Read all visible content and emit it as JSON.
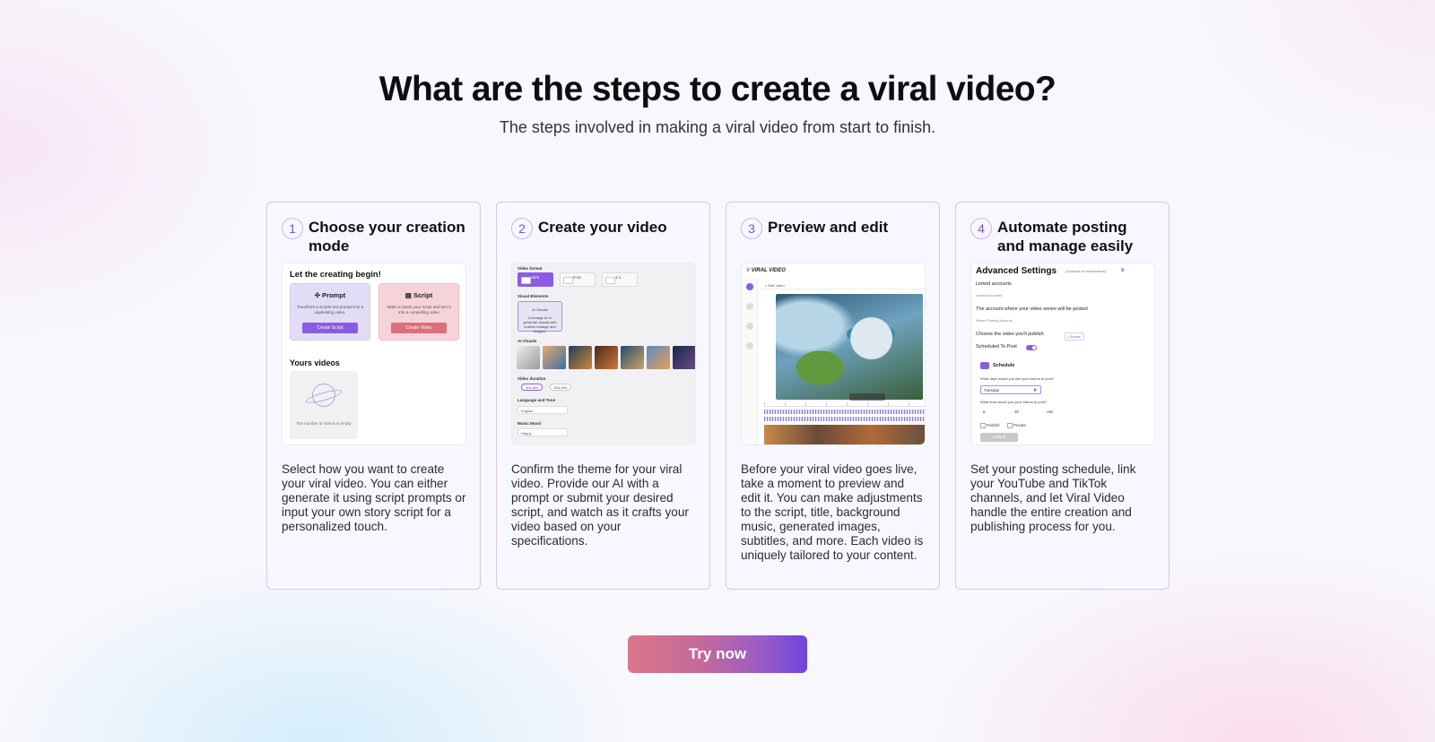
{
  "header": {
    "title": "What are the steps to create a viral video?",
    "subtitle": "The steps involved in making a viral video from start to finish."
  },
  "steps": [
    {
      "number": "1",
      "title": "Choose your creation mode",
      "description": "Select how you want to create your viral video. You can either generate it using script prompts or input your own story script for a personalized touch.",
      "preview": {
        "heading": "Let the creating begin!",
        "prompt_title": "✣ Prompt",
        "prompt_text": "Transform a simple text prompt into a captivating video.",
        "prompt_button": "Create Script",
        "script_title": "▤ Script",
        "script_text": "Write or paste your script and turn it into a compelling video",
        "script_button": "Create Video",
        "videos_heading": "Yours videos",
        "empty_text": "The number of videos is empty"
      }
    },
    {
      "number": "2",
      "title": "Create your video",
      "description": "Confirm the theme for your viral video. Provide our AI with a prompt or submit your desired script, and watch as it crafts your video based on your specifications.",
      "preview": {
        "ratio_label": "Video format",
        "ratios": [
          "16:9",
          "9:16",
          "1:1"
        ],
        "visual_label": "Visual Elements",
        "ai_visuals_title": "AI Visuals",
        "ai_visuals_text": "Leverage AI to generate visuals with custom footage and images.",
        "visuals_label": "AI Visuals",
        "duration_label": "Video duration",
        "durations": [
          "30s-60s",
          "60s-90s"
        ],
        "language_label": "Language and Tone",
        "language": "English",
        "music_label": "Music Mood",
        "music": "Happy"
      }
    },
    {
      "number": "3",
      "title": "Preview and edit",
      "description": "Before your viral video goes live, take a moment to preview and edit it. You can make adjustments to the script, title, background music, generated images, subtitles, and more. Each video is uniquely tailored to your content.",
      "preview": {
        "logo": "VIRAL VIDEO",
        "edit_label": "< Edit Video"
      }
    },
    {
      "number": "4",
      "title": "Automate posting and manage easily",
      "description": "Set your posting schedule, link your YouTube and TikTok channels, and let Viral Video handle the entire creation and publishing process for you.",
      "preview": {
        "title": "Advanced Settings",
        "note": "(Optional for subscribers)",
        "linked_label": "Linked accounts",
        "linked_field": "Linked Accounts",
        "account_label": "The account where your video series will be posted",
        "account_field": "Select Posting Account",
        "choose_label": "Choose the video you'll publish",
        "choose_chip": "Choose",
        "scheduled_label": "Scheduled To Post",
        "schedule_label": "Schedule",
        "days_label": "What days would you like your videos to post?",
        "day": "Tuesday",
        "time_label": "What time would you your videos to post?",
        "hour": "6",
        "minute": "30",
        "period": "AM",
        "publish": "Publish",
        "private": "Private",
        "submit": "Submit"
      }
    }
  ],
  "cta": {
    "label": "Try now"
  },
  "colors": {
    "accent": "#8a5ce6",
    "cta_start": "#d9768a",
    "cta_end": "#6f44dc"
  }
}
